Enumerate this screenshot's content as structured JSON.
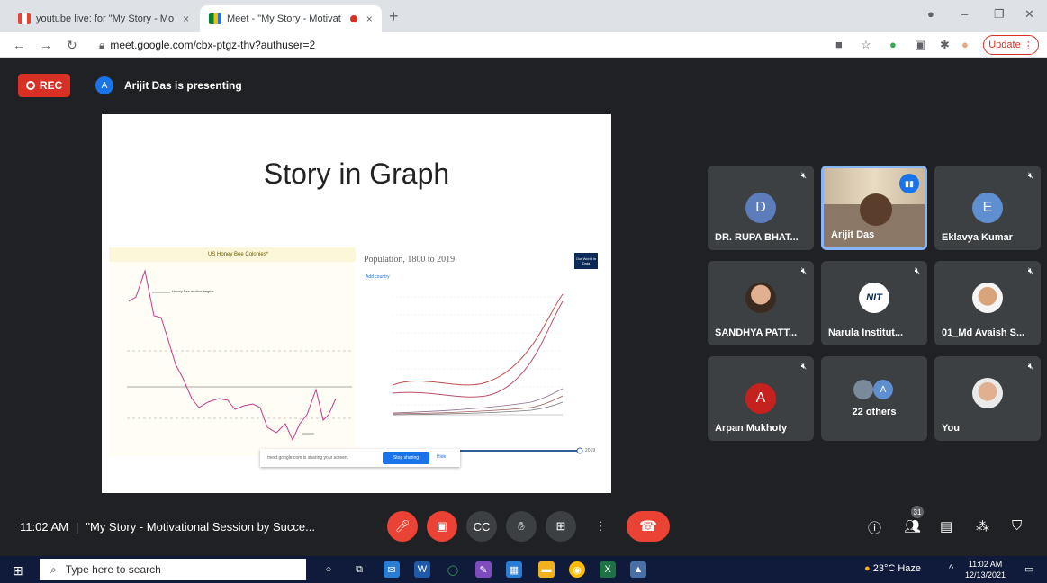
{
  "browser": {
    "tabs": [
      {
        "label": "youtube live: for \"My Story - Mo",
        "close": "×"
      },
      {
        "label": "Meet - \"My Story - Motivat",
        "close": "×"
      }
    ],
    "new_tab": "+",
    "url": "meet.google.com/cbx-ptgz-thv?authuser=2",
    "update_label": "Update"
  },
  "meet": {
    "rec_label": "REC",
    "presenter_initial": "A",
    "presenting_text": "Arijit Das is presenting",
    "slide": {
      "title": "Story in Graph",
      "left_chart_title": "US Honey Bee Colonies*",
      "left_chart_annotation": "Honey Bee decline begins",
      "right_chart_title": "Population, 1800 to 2019",
      "right_chart_logo": "Our World in Data",
      "right_chart_toggle": "Add country",
      "right_chart_end_label": "2019",
      "share_text": "meet.google.com is sharing your screen.",
      "stop_sharing": "Stop sharing",
      "hide": "Hide"
    },
    "participants": [
      {
        "name": "DR. RUPA BHAT...",
        "initial": "D",
        "color": "#5c7cbc"
      },
      {
        "name": "Arijit Das",
        "speaking": true
      },
      {
        "name": "Eklavya Kumar",
        "initial": "E",
        "color": "#5f8fd0"
      },
      {
        "name": "SANDHYA PATT..."
      },
      {
        "name": "Narula Institut...",
        "logo": "NIT"
      },
      {
        "name": "01_Md Avaish S..."
      },
      {
        "name": "Arpan Mukhoty",
        "initial": "A",
        "color": "#c5221f"
      },
      {
        "name": "22 others",
        "initial": "A"
      },
      {
        "name": "You"
      }
    ],
    "controls": {
      "time": "11:02 AM",
      "separator": "|",
      "meeting_title": "\"My Story - Motivational Session by Succe...",
      "people_count": "31"
    }
  },
  "taskbar": {
    "search_placeholder": "Type here to search",
    "weather": "23°C  Haze",
    "time": "11:02 AM",
    "date": "12/13/2021"
  }
}
